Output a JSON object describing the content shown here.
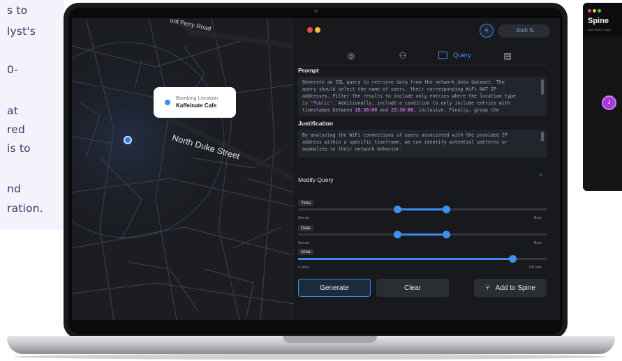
{
  "background": {
    "lines": [
      "s to",
      "lyst's",
      "0-",
      "at",
      "red",
      "is to",
      "nd",
      "ration."
    ]
  },
  "map": {
    "street_top": "ont Ferry Road",
    "street_main": "North Duke Street",
    "popup_label": "Bombing Location",
    "popup_place": "Kaffeinate Cafe"
  },
  "window": {
    "user": "Josh S."
  },
  "tabs": {
    "query_label": "Query"
  },
  "prompt": {
    "title": "Prompt",
    "l1": "Generate an SQL query to retrieve data from the network_data dataset. The",
    "l2": "query should select the name of users, their corresponding WiFi NAT IP",
    "l3": "addresses. Filter the results to include only entries where the location type",
    "l4a": "is '",
    "l4b": "Public",
    "l4c": "'. Additionally, include a condition to only include entries with",
    "l5a": "timestamps between ",
    "l5b": "18:30:00",
    "l5c": " and ",
    "l5d": "23:30:00",
    "l5e": ", inclusive. Finally, group the"
  },
  "justification": {
    "title": "Justification",
    "l1": "By analyzing the WiFi connections of users associated with the provided IP",
    "l2": "address within a specific timeframe, we can identify potential patterns or",
    "l3": "anomalies in their network behavior."
  },
  "modify": {
    "title": "Modify Query",
    "time_label": "Time",
    "date_label": "Date",
    "area_label": "Area",
    "narrow": "Narrow",
    "broad": "Broa",
    "area_min": "0 miles",
    "area_max": "100 mile"
  },
  "actions": {
    "generate": "Generate",
    "clear": "Clear",
    "add_to_spine": "Add to Spine"
  },
  "side_app": {
    "title": "Spine",
    "subtitle": "Josh Smith | Upda",
    "avatar_initial": "J"
  },
  "colors": {
    "accent": "#3d8bea",
    "highlight": "#d56cf2",
    "close": "#ec4c4c",
    "minimize": "#f2c23a",
    "maximize": "#3fc25a"
  }
}
